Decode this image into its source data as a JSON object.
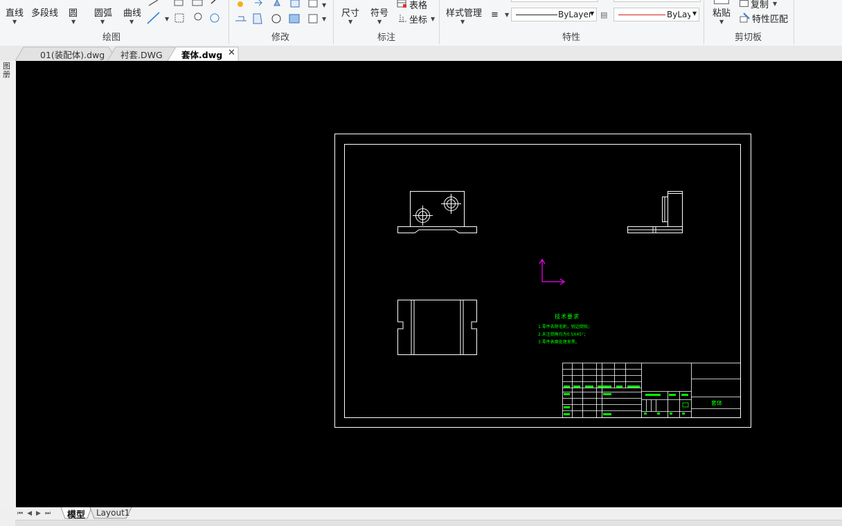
{
  "ribbon": {
    "draw": {
      "line": "直线",
      "polyline": "多段线",
      "circle": "圆",
      "arc": "圆弧",
      "curve": "曲线",
      "panel_label": "绘图"
    },
    "modify": {
      "panel_label": "修改"
    },
    "annotate": {
      "dimension": "尺寸",
      "symbol": "符号",
      "table": "表格",
      "coordinate": "坐标",
      "panel_label": "标注"
    },
    "properties": {
      "style_manager": "样式管理",
      "linetype_value": "ByLayer",
      "color_value": "ByLayer",
      "panel_label": "特性"
    },
    "clipboard": {
      "paste": "粘贴",
      "copy": "复制",
      "match_properties": "特性匹配",
      "panel_label": "剪切板"
    }
  },
  "tabs": [
    {
      "label": "01(装配体).dwg"
    },
    {
      "label": "衬套.DWG"
    },
    {
      "label": "套体.dwg",
      "active": true
    }
  ],
  "left_strip_label": "图 册",
  "drawing": {
    "tech_title": "技术要求",
    "tech_lines": [
      "1.零件去除毛刺，锐边倒钝；",
      "2.未注倒角均为0.5X45°；",
      "3.零件表面处理发黑。"
    ],
    "titleblock_part_name": "套体",
    "colors": {
      "border": "#ffffff",
      "text": "#00ff00",
      "ucs": "#ff00ff"
    }
  },
  "layout_tabs": {
    "model": "模型",
    "layout1": "Layout1"
  }
}
